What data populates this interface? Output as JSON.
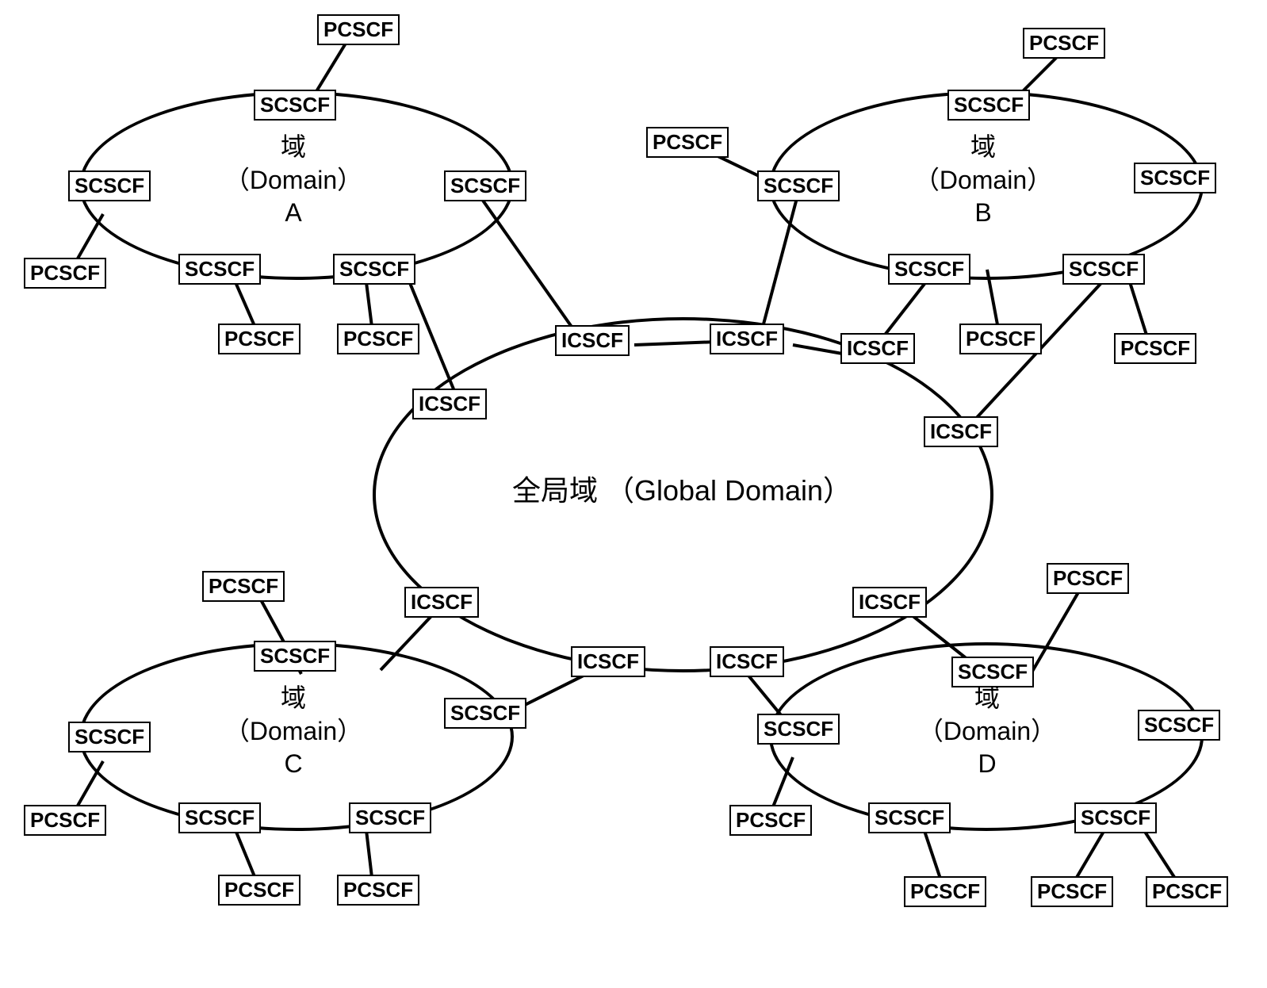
{
  "global": {
    "label": "全局域 （Global Domain）",
    "icscf": "ICSCF"
  },
  "domains": {
    "A": {
      "label_line1": "域",
      "label_line2": "（Domain）",
      "label_line3": "A"
    },
    "B": {
      "label_line1": "域",
      "label_line2": "（Domain）",
      "label_line3": "B"
    },
    "C": {
      "label_line1": "域",
      "label_line2": "（Domain）",
      "label_line3": "C"
    },
    "D": {
      "label_line1": "域",
      "label_line2": "（Domain）",
      "label_line3": "D"
    }
  },
  "node_types": {
    "scscf": "SCSCF",
    "pcscf": "PCSCF"
  }
}
